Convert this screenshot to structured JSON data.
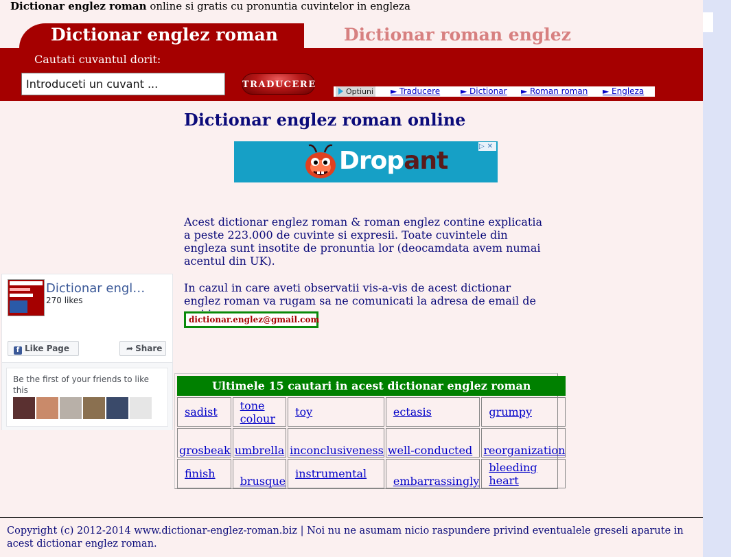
{
  "header": {
    "site_name_bold": "Dictionar englez roman",
    "site_tagline": "online si gratis cu pronuntia cuvintelor in engleza"
  },
  "tabs": {
    "active_label": "Dictionar englez roman",
    "inactive_label": "Dictionar roman englez"
  },
  "search": {
    "label": "Cautati cuvantul dorit:",
    "value": "Introduceti un cuvant ...",
    "button_label": "TRADUCERE"
  },
  "options_bar": {
    "options_label": "Optiuni",
    "links": [
      "► Traducere",
      "► Dictionar",
      "► Roman roman",
      "► Engleza"
    ]
  },
  "main": {
    "title": "Dictionar englez roman online",
    "ad_text_main": "Drop",
    "ad_text_accent": "ant",
    "ad_controls": "▷✕",
    "paragraph1": "Acest dictionar englez roman & roman englez contine explicatia a peste 223.000 de cuvinte si expresii. Toate cuvintele din engleza sunt insotite de pronuntia lor (deocamdata avem numai acentul din UK).",
    "paragraph2": "In cazul in care aveti observatii vis-a-vis de acest dictionar englez roman va rugam sa ne comunicati la adresa de email de mai jos :",
    "email": "dictionar.englez@gmail.com"
  },
  "facebook": {
    "page_name": "Dictionar engl…",
    "likes": "270 likes",
    "like_button": "Like Page",
    "share_button": "Share",
    "friends_text": "Be the first of your friends to like this",
    "face_colors": [
      "#5a3030",
      "#c98a6a",
      "#b8b0a8",
      "#8a7050",
      "#3a4a6a",
      "#e6e6e6"
    ]
  },
  "recent_searches": {
    "title": "Ultimele 15 cautari in acest dictionar englez roman",
    "rows": [
      [
        "sadist",
        "tone colour",
        "toy",
        "ectasis",
        "grumpy"
      ],
      [
        "grosbeak",
        "umbrella",
        "inconclusiveness",
        "well-conducted",
        "reorganization"
      ],
      [
        "finish",
        "brusque",
        "instrumental",
        "embarrassingly",
        "bleeding heart"
      ]
    ]
  },
  "footer": {
    "text": "Copyright (c) 2012-2014 www.dictionar-englez-roman.biz | Noi nu ne asumam nicio raspundere privind eventualele greseli aparute in acest dictionar englez roman."
  },
  "colors": {
    "brand_red": "#a50000",
    "title_navy": "#0b0b7a",
    "table_header_green": "#008000",
    "link_blue": "#0000c8",
    "page_bg": "#fbf0f0"
  }
}
